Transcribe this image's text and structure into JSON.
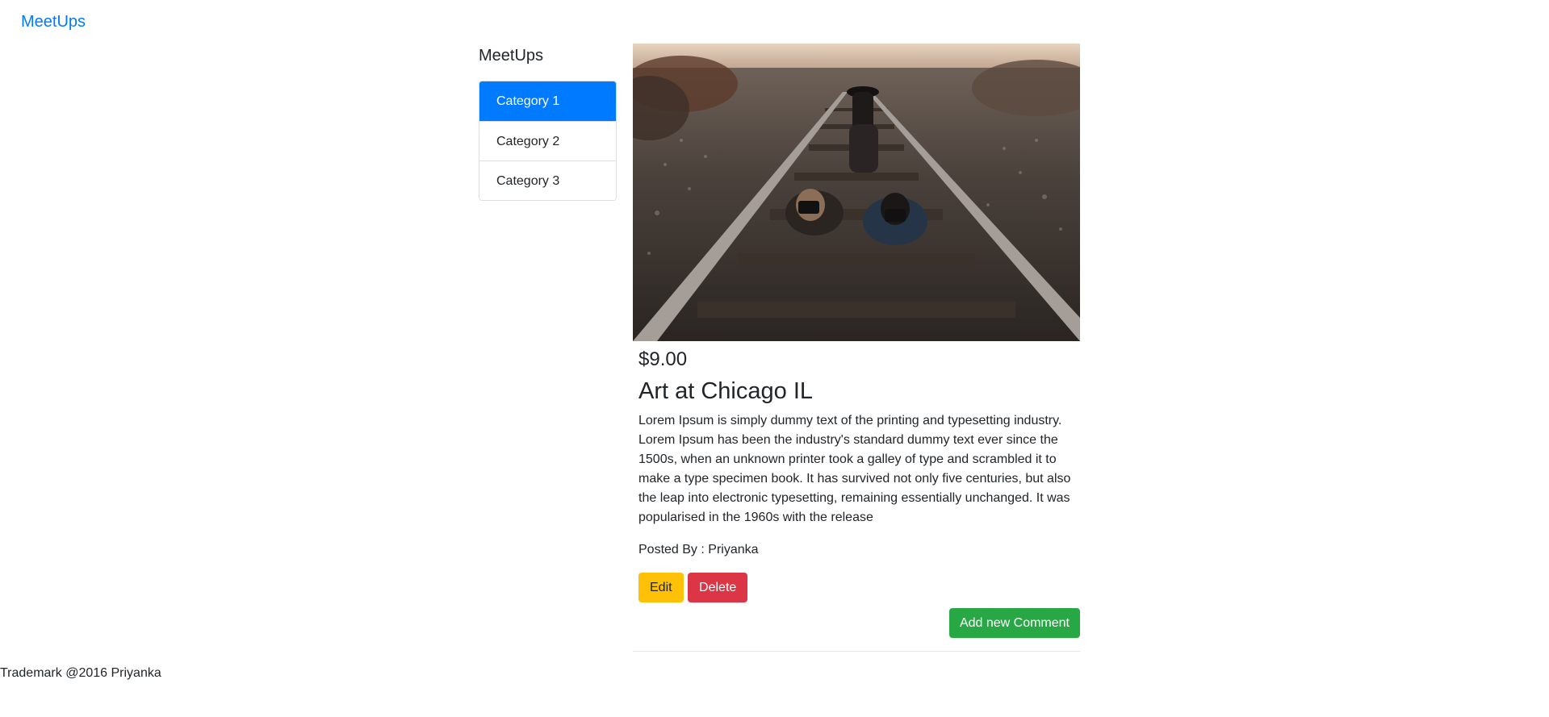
{
  "navbar": {
    "brand": "MeetUps"
  },
  "sidebar": {
    "title": "MeetUps",
    "items": [
      {
        "label": "Category 1",
        "active": true
      },
      {
        "label": "Category 2",
        "active": false
      },
      {
        "label": "Category 3",
        "active": false
      }
    ]
  },
  "event": {
    "price": "$9.00",
    "title": "Art at Chicago IL",
    "description": "Lorem Ipsum is simply dummy text of the printing and typesetting industry. Lorem Ipsum has been the industry's standard dummy text ever since the 1500s, when an unknown printer took a galley of type and scrambled it to make a type specimen book. It has survived not only five centuries, but also the leap into electronic typesetting, remaining essentially unchanged. It was popularised in the 1960s with the release",
    "posted_by": "Posted By : Priyanka",
    "edit_label": "Edit",
    "delete_label": "Delete",
    "add_comment_label": "Add new Comment"
  },
  "footer": {
    "text": "Trademark @2016 Priyanka"
  },
  "colors": {
    "primary": "#007bff",
    "warning": "#ffc107",
    "danger": "#dc3545",
    "success": "#28a745"
  }
}
